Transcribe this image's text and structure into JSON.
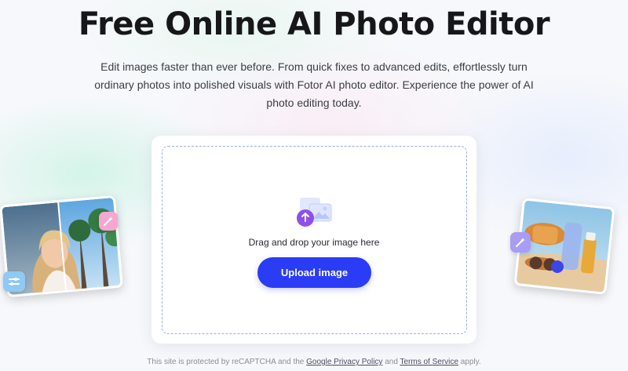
{
  "hero": {
    "title": "Free Online AI Photo Editor",
    "subtitle": "Edit images faster than ever before. From quick fixes to advanced edits, effortlessly turn ordinary photos into polished visuals with Fotor AI photo editor. Experience the power of AI photo editing today."
  },
  "uploader": {
    "drop_text": "Drag and drop your image here",
    "button_label": "Upload image",
    "icon": "upload-image-icon"
  },
  "footer": {
    "prefix": "This site is protected by reCAPTCHA and the",
    "privacy_link": "Google Privacy Policy",
    "and": "and",
    "terms_link": "Terms of Service",
    "suffix": "apply."
  },
  "showcase": {
    "left_image": "portrait-before-after-image",
    "left_badge_icon": "magic-wand-icon",
    "left_slider_icon": "sliders-icon",
    "right_image": "beach-product-image",
    "right_badge_icon": "magic-wand-icon"
  },
  "colors": {
    "accent": "#2a3cf5",
    "drop_border": "#9aaee8",
    "badge_pink": "#f6a6cf",
    "badge_blue": "#8fc9f4",
    "badge_purple": "#a99cf3"
  }
}
